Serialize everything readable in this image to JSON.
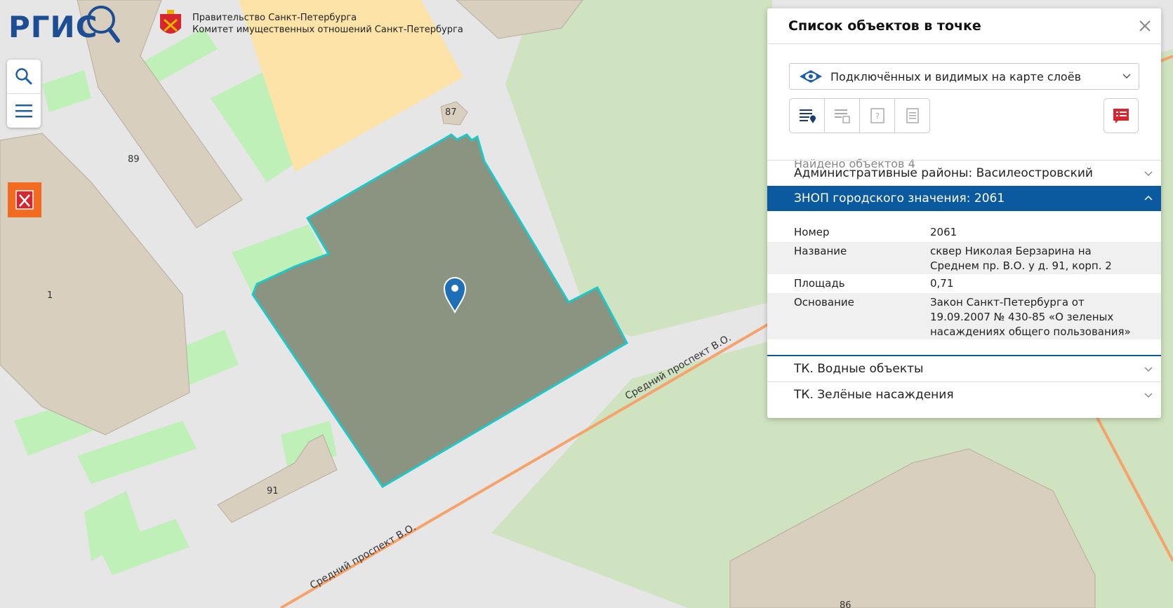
{
  "header": {
    "logo_text": "РГИС",
    "gov_line1": "Правительство Санкт-Петербурга",
    "gov_line2": "Комитет имущественных отношений Санкт-Петербурга"
  },
  "toolbar": {
    "search_icon": "search-icon",
    "menu_icon": "hamburger-menu-icon",
    "spb_icon": "spb-emblem-icon"
  },
  "map": {
    "building_numbers": [
      "87",
      "89",
      "1",
      "91",
      "86"
    ],
    "street_label": "Средний проспект В.О.",
    "colors": {
      "road": "#e6e6e6",
      "green": "#cfe3c0",
      "light_green": "#bff0b8",
      "building": "#d9cfbe",
      "school": "#fde3a7",
      "selected_fill": "#8b9481",
      "selected_outline": "#1ec8c8",
      "road_orange": "#f5a36a",
      "marker": "#1e6fb8"
    }
  },
  "panel": {
    "title": "Список объектов в точке",
    "close_icon": "close-icon",
    "layer_select": "Подключённых и видимых на карте слоёв",
    "found": "Найдено объектов 4",
    "sections": [
      {
        "label": "Административные районы: Василеостровский",
        "expanded": false
      },
      {
        "label": "ЗНОП городского значения: 2061",
        "expanded": true
      },
      {
        "label": "ТК. Водные объекты",
        "expanded": false
      },
      {
        "label": "ТК. Зелёные насаждения",
        "expanded": false
      }
    ],
    "attributes": [
      {
        "key": "Номер",
        "value": "2061"
      },
      {
        "key": "Название",
        "value": "сквер Николая Берзарина на Среднем пр. В.О. у д. 91, корп. 2"
      },
      {
        "key": "Площадь",
        "value": "0,71"
      },
      {
        "key": "Основание",
        "value": "Закон Санкт-Петербурга от 19.09.2007 № 430-85 «О зеленых насаждениях общего пользования»"
      }
    ]
  }
}
